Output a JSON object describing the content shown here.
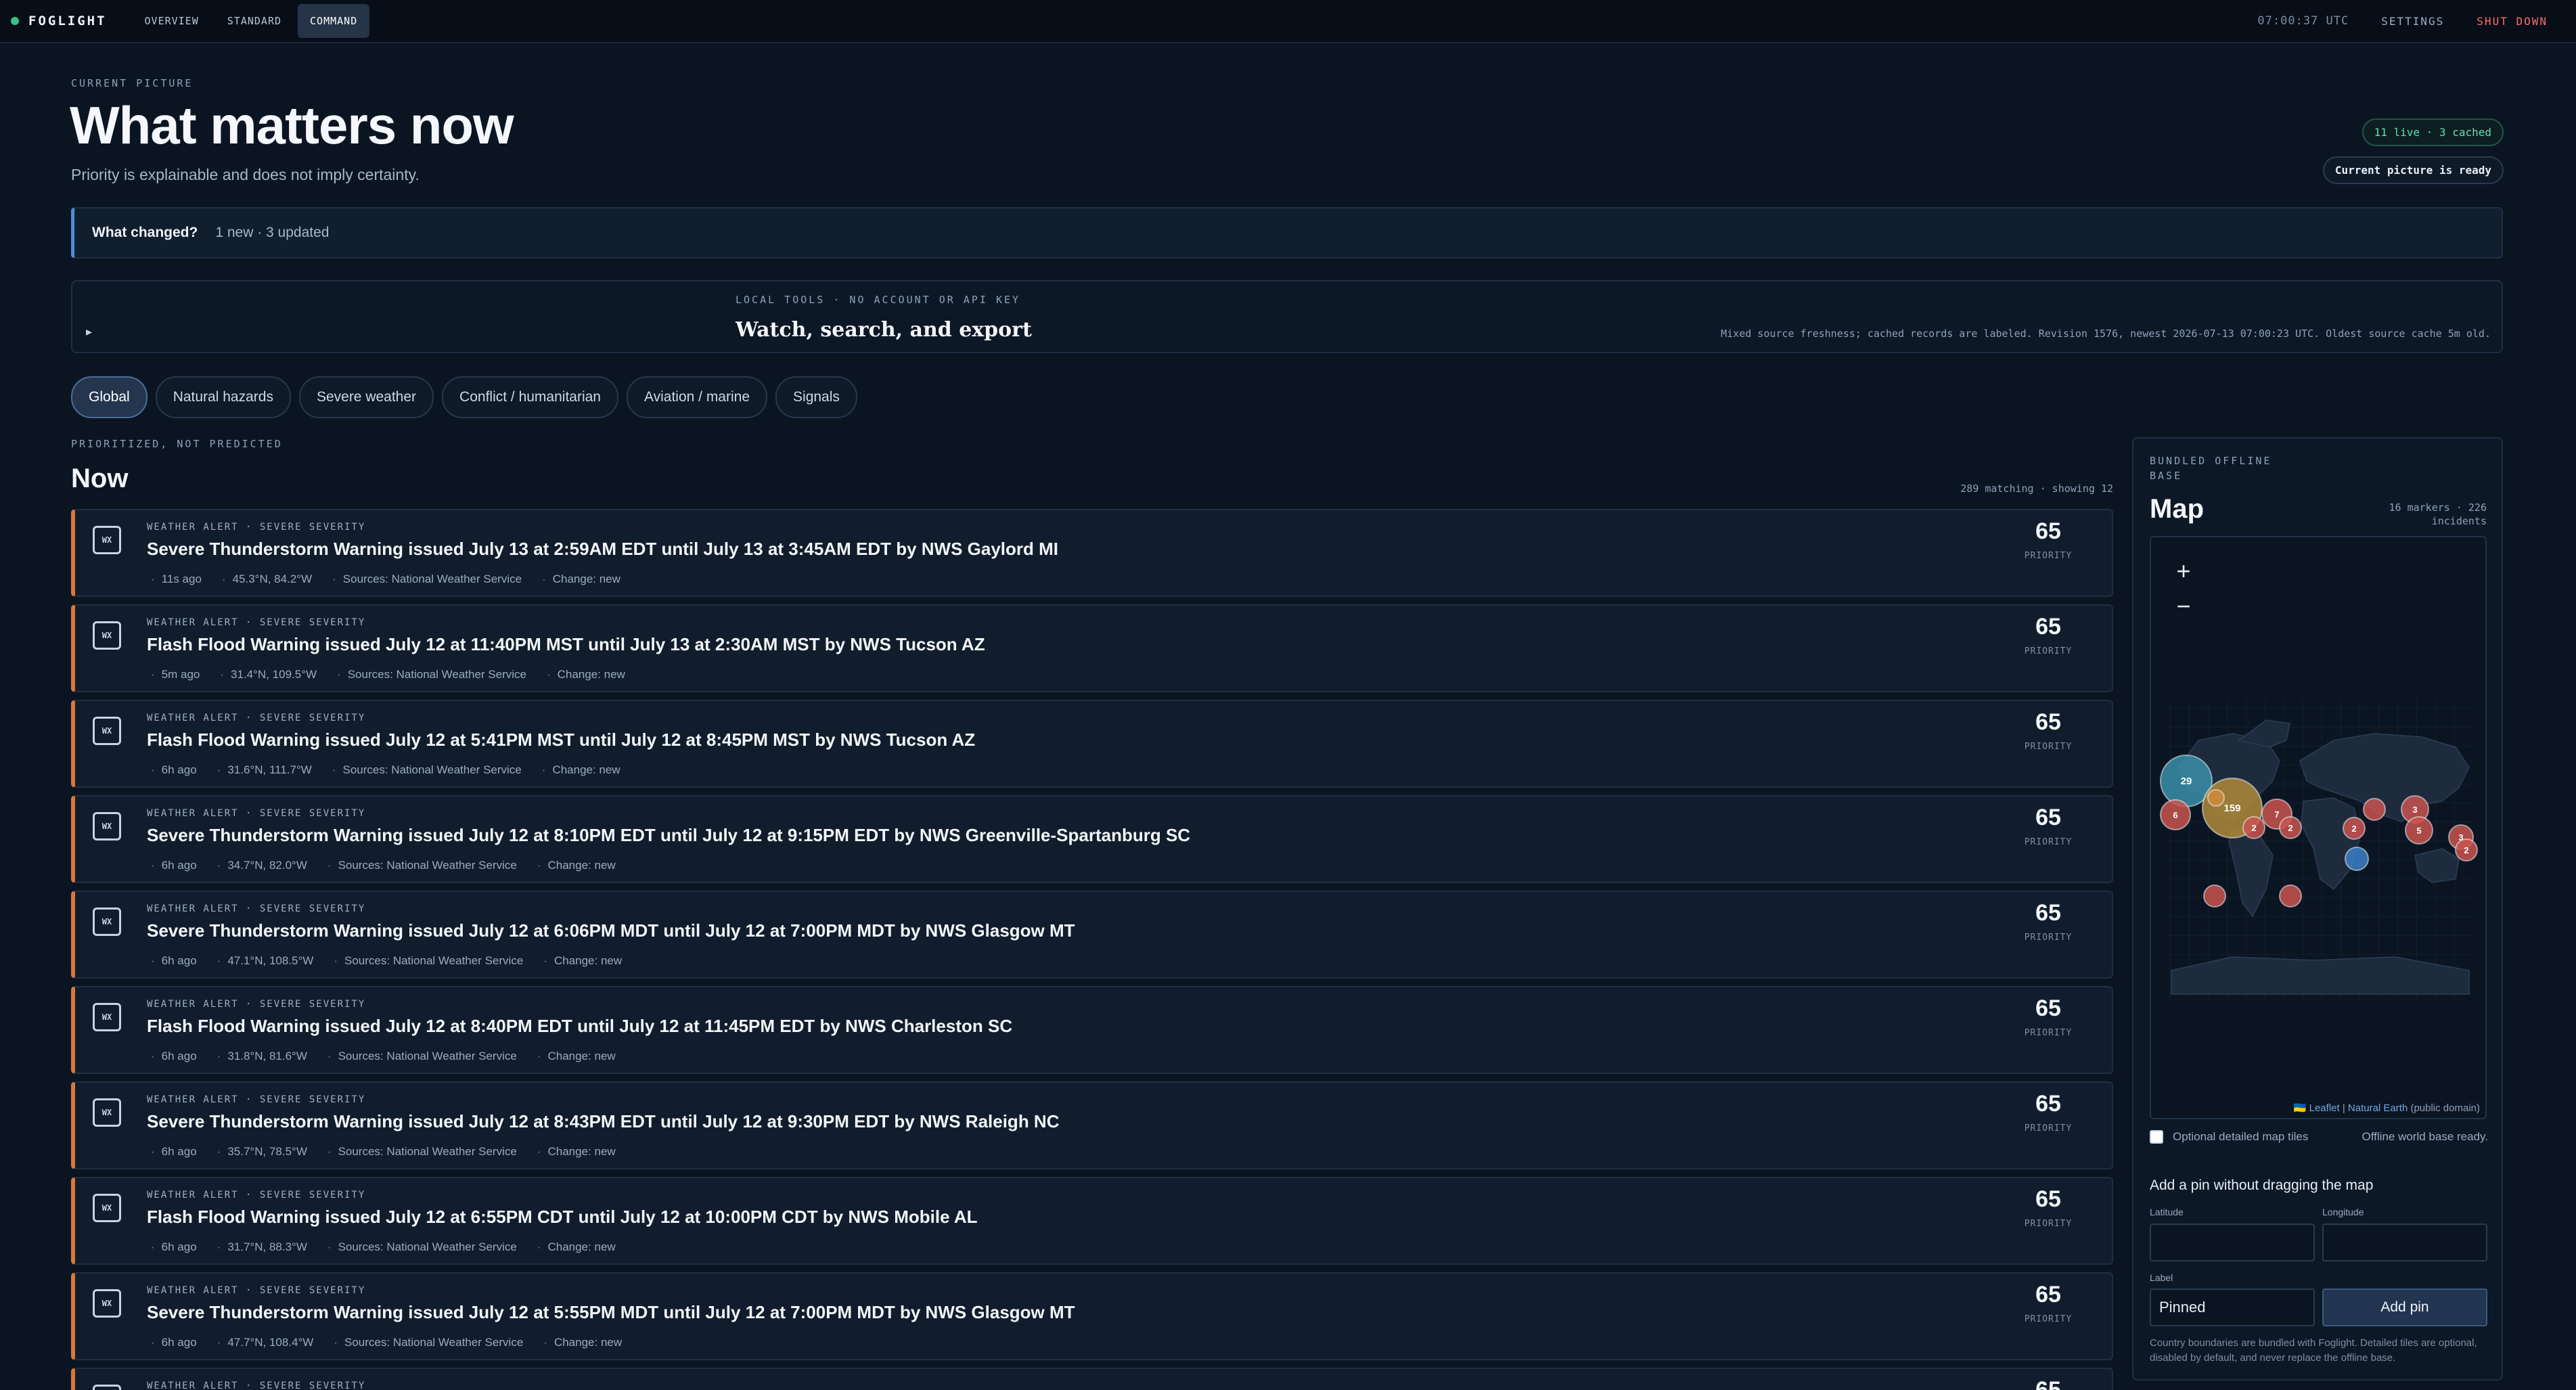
{
  "app": {
    "brand": "FOGLIGHT",
    "tabs": [
      "OVERVIEW",
      "STANDARD",
      "COMMAND"
    ],
    "active_tab": "COMMAND",
    "clock": "07:00:37 UTC",
    "settings_label": "SETTINGS",
    "shutdown_label": "SHUT DOWN"
  },
  "header": {
    "eyebrow": "CURRENT PICTURE",
    "title": "What matters now",
    "subtitle": "Priority is explainable and does not imply certainty.",
    "live_pill": "11 live · 3 cached",
    "ready_pill": "Current picture is ready"
  },
  "changed": {
    "label": "What changed?",
    "value": "1 new · 3 updated"
  },
  "tools": {
    "caret": "▸",
    "eyebrow": "LOCAL TOOLS · NO ACCOUNT OR API KEY",
    "title": "Watch, search, and export",
    "note": "Mixed source freshness; cached records are labeled. Revision 1576, newest 2026-07-13 07:00:23 UTC. Oldest source cache 5m old."
  },
  "filters": [
    "Global",
    "Natural hazards",
    "Severe weather",
    "Conflict / humanitarian",
    "Aviation / marine",
    "Signals"
  ],
  "active_filter": "Global",
  "list": {
    "eyebrow": "PRIORITIZED, NOT PREDICTED",
    "title": "Now",
    "count": "289 matching · showing 12",
    "score_label": "PRIORITY",
    "badge": "WX",
    "items": [
      {
        "kicker": "WEATHER ALERT · SEVERE SEVERITY",
        "title": "Severe Thunderstorm Warning issued July 13 at 2:59AM EDT until July 13 at 3:45AM EDT by NWS Gaylord MI",
        "age": "11s ago",
        "coords": "45.3°N, 84.2°W",
        "sources": "Sources: National Weather Service",
        "change": "Change: new",
        "score": "65"
      },
      {
        "kicker": "WEATHER ALERT · SEVERE SEVERITY",
        "title": "Flash Flood Warning issued July 12 at 11:40PM MST until July 13 at 2:30AM MST by NWS Tucson AZ",
        "age": "5m ago",
        "coords": "31.4°N, 109.5°W",
        "sources": "Sources: National Weather Service",
        "change": "Change: new",
        "score": "65"
      },
      {
        "kicker": "WEATHER ALERT · SEVERE SEVERITY",
        "title": "Flash Flood Warning issued July 12 at 5:41PM MST until July 12 at 8:45PM MST by NWS Tucson AZ",
        "age": "6h ago",
        "coords": "31.6°N, 111.7°W",
        "sources": "Sources: National Weather Service",
        "change": "Change: new",
        "score": "65"
      },
      {
        "kicker": "WEATHER ALERT · SEVERE SEVERITY",
        "title": "Severe Thunderstorm Warning issued July 12 at 8:10PM EDT until July 12 at 9:15PM EDT by NWS Greenville-Spartanburg SC",
        "age": "6h ago",
        "coords": "34.7°N, 82.0°W",
        "sources": "Sources: National Weather Service",
        "change": "Change: new",
        "score": "65"
      },
      {
        "kicker": "WEATHER ALERT · SEVERE SEVERITY",
        "title": "Severe Thunderstorm Warning issued July 12 at 6:06PM MDT until July 12 at 7:00PM MDT by NWS Glasgow MT",
        "age": "6h ago",
        "coords": "47.1°N, 108.5°W",
        "sources": "Sources: National Weather Service",
        "change": "Change: new",
        "score": "65"
      },
      {
        "kicker": "WEATHER ALERT · SEVERE SEVERITY",
        "title": "Flash Flood Warning issued July 12 at 8:40PM EDT until July 12 at 11:45PM EDT by NWS Charleston SC",
        "age": "6h ago",
        "coords": "31.8°N, 81.6°W",
        "sources": "Sources: National Weather Service",
        "change": "Change: new",
        "score": "65"
      },
      {
        "kicker": "WEATHER ALERT · SEVERE SEVERITY",
        "title": "Severe Thunderstorm Warning issued July 12 at 8:43PM EDT until July 12 at 9:30PM EDT by NWS Raleigh NC",
        "age": "6h ago",
        "coords": "35.7°N, 78.5°W",
        "sources": "Sources: National Weather Service",
        "change": "Change: new",
        "score": "65"
      },
      {
        "kicker": "WEATHER ALERT · SEVERE SEVERITY",
        "title": "Flash Flood Warning issued July 12 at 6:55PM CDT until July 12 at 10:00PM CDT by NWS Mobile AL",
        "age": "6h ago",
        "coords": "31.7°N, 88.3°W",
        "sources": "Sources: National Weather Service",
        "change": "Change: new",
        "score": "65"
      },
      {
        "kicker": "WEATHER ALERT · SEVERE SEVERITY",
        "title": "Severe Thunderstorm Warning issued July 12 at 5:55PM MDT until July 12 at 7:00PM MDT by NWS Glasgow MT",
        "age": "6h ago",
        "coords": "47.7°N, 108.4°W",
        "sources": "Sources: National Weather Service",
        "change": "Change: new",
        "score": "65"
      },
      {
        "kicker": "WEATHER ALERT · SEVERE SEVERITY",
        "title": "",
        "age": "",
        "coords": "",
        "sources": "",
        "change": "",
        "score": "65"
      }
    ]
  },
  "map": {
    "eyebrow": "BUNDLED OFFLINE BASE",
    "title": "Map",
    "count": "16 markers · 226 incidents",
    "zoom_in": "+",
    "zoom_out": "−",
    "attribution_flag": "🇺🇦",
    "attribution_leaflet": "Leaflet",
    "attribution_separator": " | ",
    "attribution_ne": "Natural Earth",
    "attribution_suffix": " (public domain)",
    "clusters": [
      {
        "label": "29",
        "color": "#3a8fa8"
      },
      {
        "label": "159",
        "color": "#b08a3a"
      },
      {
        "label": "6",
        "color": "#c9534f"
      },
      {
        "label": "7",
        "color": "#c9534f"
      },
      {
        "label": "2",
        "color": "#c9534f"
      },
      {
        "label": "2",
        "color": "#c9534f"
      },
      {
        "label": "2",
        "color": "#c9534f"
      },
      {
        "label": "3",
        "color": "#c9534f"
      },
      {
        "label": "5",
        "color": "#c9534f"
      },
      {
        "label": "3",
        "color": "#c9534f"
      },
      {
        "label": "2",
        "color": "#c9534f"
      },
      {
        "label": "",
        "color": "#c9534f"
      },
      {
        "label": "",
        "color": "#c9534f"
      },
      {
        "label": "",
        "color": "#c9534f"
      },
      {
        "label": "",
        "color": "#3b7fc4"
      },
      {
        "label": "",
        "color": "#d08a3a"
      }
    ],
    "tiles_label": "Optional detailed map tiles",
    "tiles_status": "Offline world base ready.",
    "pin_title": "Add a pin without dragging the map",
    "lat_label": "Latitude",
    "lon_label": "Longitude",
    "label_label": "Label",
    "label_value": "Pinned",
    "add_pin_label": "Add pin",
    "footnote": "Country boundaries are bundled with Foglight. Detailed tiles are optional, disabled by default, and never replace the offline base."
  },
  "colors": {
    "background": "#0b1522",
    "accent_orange": "#d9783a",
    "live_green": "#5fe0b0",
    "danger": "#ff6b6b"
  }
}
